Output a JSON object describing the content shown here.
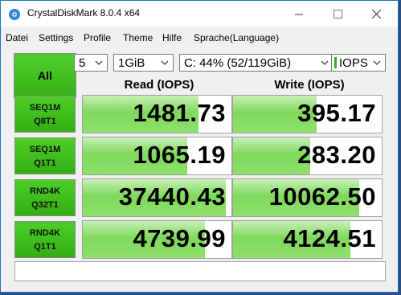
{
  "window": {
    "title": "CrystalDiskMark 8.0.4 x64"
  },
  "menu": [
    "Datei",
    "Settings",
    "Profile",
    "Theme",
    "Hilfe",
    "Sprache(Language)"
  ],
  "controls": {
    "all_label": "All",
    "count": "5",
    "size": "1GiB",
    "drive": "C: 44% (52/119GiB)",
    "unit": "IOPS"
  },
  "headers": {
    "read": "Read (IOPS)",
    "write": "Write (IOPS)"
  },
  "rows": [
    {
      "line1": "SEQ1M",
      "line2": "Q8T1",
      "read": "1481.73",
      "write": "395.17",
      "read_level": 0.78,
      "write_level": 0.56
    },
    {
      "line1": "SEQ1M",
      "line2": "Q1T1",
      "read": "1065.19",
      "write": "283.20",
      "read_level": 0.7,
      "write_level": 0.52
    },
    {
      "line1": "RND4K",
      "line2": "Q32T1",
      "read": "37440.43",
      "write": "10062.50",
      "read_level": 0.96,
      "write_level": 0.85
    },
    {
      "line1": "RND4K",
      "line2": "Q1T1",
      "read": "4739.99",
      "write": "4124.51",
      "read_level": 0.82,
      "write_level": 0.79
    }
  ],
  "comment": ""
}
